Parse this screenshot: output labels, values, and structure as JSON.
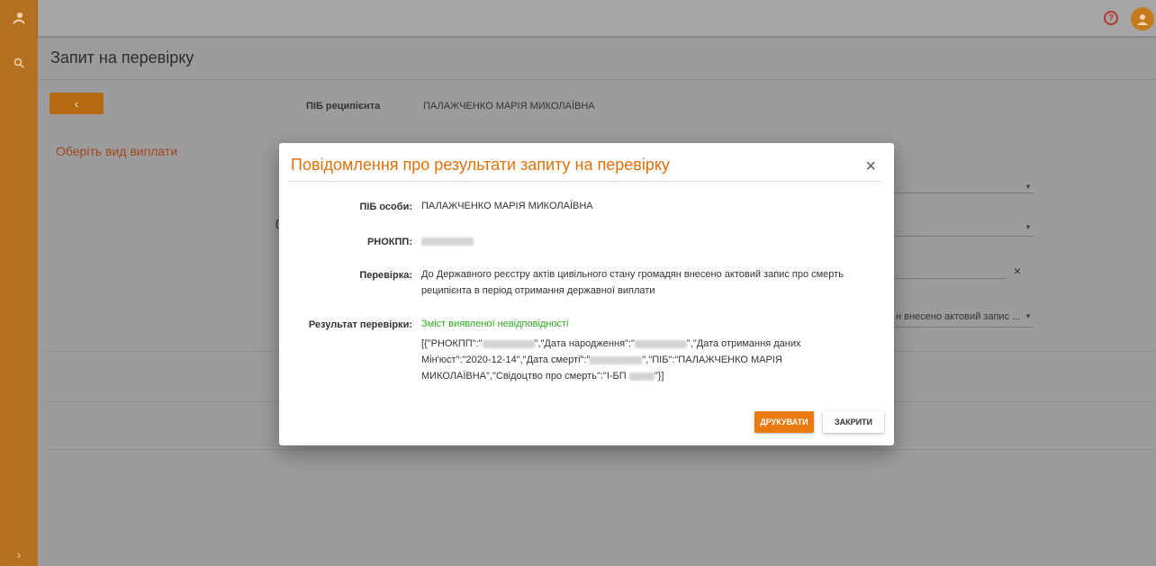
{
  "rail": {
    "logo_icon": "leaf-person-icon",
    "search_icon": "search-icon",
    "expand_icon": "chevron-right-icon"
  },
  "topbar": {
    "help_icon": "help-icon",
    "avatar_icon": "user-icon"
  },
  "page": {
    "title": "Запит на перевірку",
    "back_label": "‹",
    "recipient_label": "ПІБ реципієнта",
    "recipient_value": "ПАЛАЖЧЕНКО МАРІЯ МИКОЛАЇВНА",
    "select_payment": "Оберіть вид виплати",
    "partial_select_text": "н внесено актовий запис ..."
  },
  "modal": {
    "title": "Повідомлення про результати запиту на перевірку",
    "close_symbol": "×",
    "person_label": "ПІБ особи:",
    "person_value": "ПАЛАЖЧЕНКО МАРІЯ МИКОЛАЇВНА",
    "rnokpp_label": "РНОКПП:",
    "check_label": "Перевірка:",
    "check_value": "До Державного реєстру актів цивільного стану громадян внесено актовий запис про смерть реципієнта в період отримання державної виплати",
    "result_label": "Результат перевірки:",
    "result_heading": "Зміст виявленої невідповідності",
    "result_json": {
      "p1": "[{\"РНОКПП\":\"",
      "p2": "\",\"Дата народження\":\"",
      "p3": "\",\"Дата отримання даних Мін'юст\":\"2020-12-14\",\"Дата смерті\":\"",
      "p4": "\",\"ПІБ\":\"ПАЛАЖЧЕНКО МАРІЯ МИКОЛАЇВНА\",\"Свідоцтво про смерть\":\"І-БП ",
      "p5": "\"}]"
    },
    "print_button": "ДРУКУВАТИ",
    "close_button": "ЗАКРИТИ"
  },
  "colors": {
    "accent": "#ea7a0f",
    "success": "#2fae1e",
    "rail": "#b5711f"
  }
}
